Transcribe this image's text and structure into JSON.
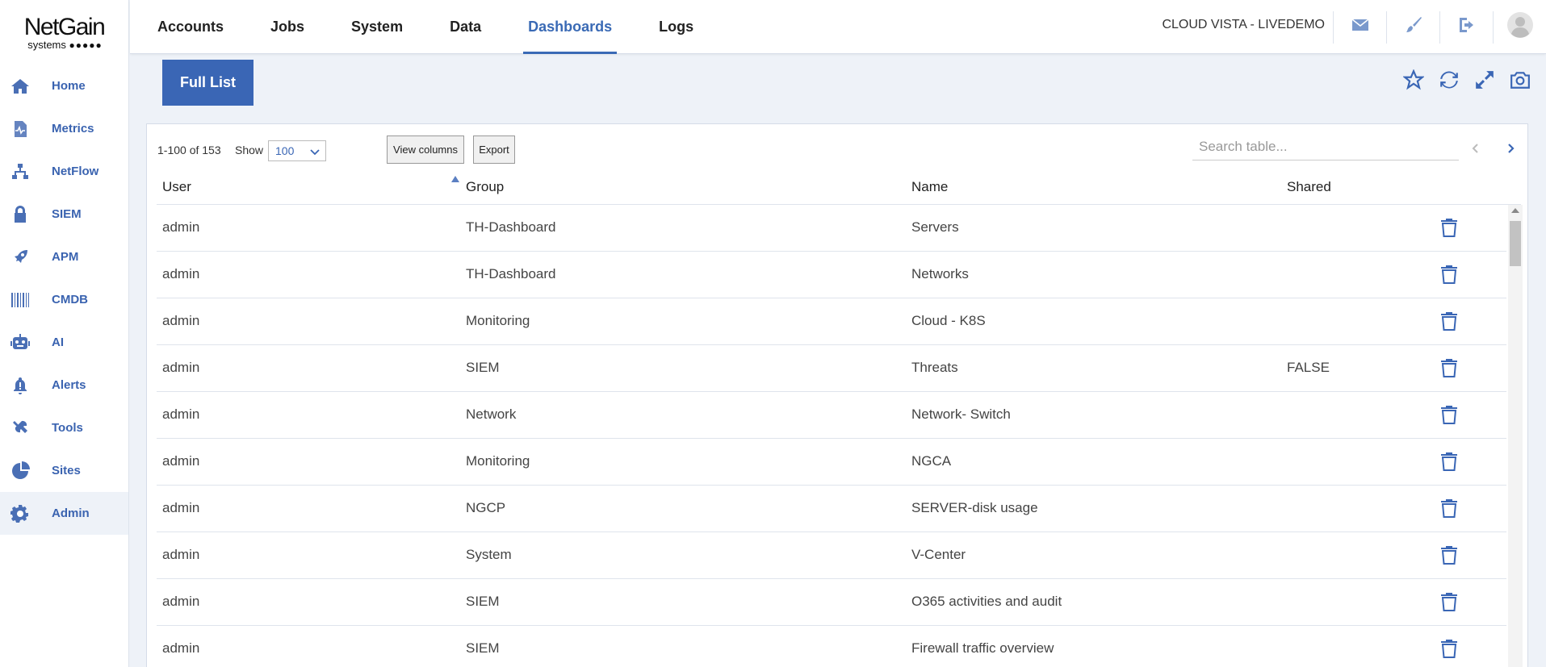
{
  "logo": {
    "main": "NetGain",
    "sub": "systems",
    "dots": "●●●●●"
  },
  "sidebar": {
    "items": [
      {
        "label": "Home",
        "icon": "home-icon"
      },
      {
        "label": "Metrics",
        "icon": "metrics-icon"
      },
      {
        "label": "NetFlow",
        "icon": "netflow-icon"
      },
      {
        "label": "SIEM",
        "icon": "lock-icon"
      },
      {
        "label": "APM",
        "icon": "rocket-icon"
      },
      {
        "label": "CMDB",
        "icon": "barcode-icon"
      },
      {
        "label": "AI",
        "icon": "robot-icon"
      },
      {
        "label": "Alerts",
        "icon": "bell-icon"
      },
      {
        "label": "Tools",
        "icon": "tools-icon"
      },
      {
        "label": "Sites",
        "icon": "pie-icon"
      },
      {
        "label": "Admin",
        "icon": "gear-icon"
      }
    ],
    "active": "Admin"
  },
  "topnav": {
    "tabs": [
      "Accounts",
      "Jobs",
      "System",
      "Data",
      "Dashboards",
      "Logs"
    ],
    "active": "Dashboards",
    "env_label": "CLOUD VISTA - LIVEDEMO"
  },
  "subheader": {
    "button_label": "Full List"
  },
  "table": {
    "count": "1-100 of 153",
    "show_label": "Show",
    "show_value": "100",
    "view_columns_label": "View columns",
    "export_label": "Export",
    "search_placeholder": "Search table...",
    "columns": [
      "User",
      "Group",
      "Name",
      "Shared"
    ],
    "sort_column": "User",
    "sort_direction": "ascending",
    "rows": [
      {
        "user": "admin",
        "group": "TH-Dashboard",
        "name": "Servers",
        "shared": ""
      },
      {
        "user": "admin",
        "group": "TH-Dashboard",
        "name": "Networks",
        "shared": ""
      },
      {
        "user": "admin",
        "group": "Monitoring",
        "name": "Cloud - K8S",
        "shared": ""
      },
      {
        "user": "admin",
        "group": "SIEM",
        "name": "Threats",
        "shared": "FALSE"
      },
      {
        "user": "admin",
        "group": "Network",
        "name": "Network- Switch",
        "shared": ""
      },
      {
        "user": "admin",
        "group": "Monitoring",
        "name": "NGCA",
        "shared": ""
      },
      {
        "user": "admin",
        "group": "NGCP",
        "name": "SERVER-disk usage",
        "shared": ""
      },
      {
        "user": "admin",
        "group": "System",
        "name": "V-Center",
        "shared": ""
      },
      {
        "user": "admin",
        "group": "SIEM",
        "name": "O365 activities and audit",
        "shared": ""
      },
      {
        "user": "admin",
        "group": "SIEM",
        "name": "Firewall traffic overview",
        "shared": ""
      }
    ]
  },
  "colors": {
    "accent": "#3a66b5",
    "nav_text": "#3a63b0",
    "background": "#eef2f8"
  }
}
